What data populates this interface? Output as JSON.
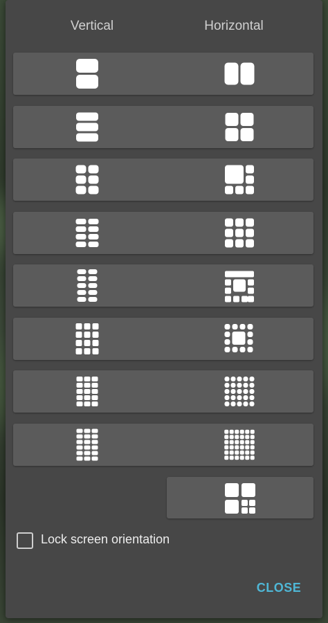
{
  "header": {
    "vertical_label": "Vertical",
    "horizontal_label": "Horizontal"
  },
  "layout_rows": [
    {
      "vertical_icon": "vertical-2-stack-icon",
      "horizontal_icon": "horizontal-2-side-icon"
    },
    {
      "vertical_icon": "vertical-3-stack-icon",
      "horizontal_icon": "grid-2x2-icon"
    },
    {
      "vertical_icon": "grid-2x3-icon",
      "horizontal_icon": "big-plus-5-small-icon"
    },
    {
      "vertical_icon": "grid-2x4-icon",
      "horizontal_icon": "grid-3x3-icon"
    },
    {
      "vertical_icon": "grid-2x5-icon",
      "horizontal_icon": "grid-4x4-two-big-icon"
    },
    {
      "vertical_icon": "grid-3x4-icon",
      "horizontal_icon": "grid-4x4-center-big-icon"
    },
    {
      "vertical_icon": "grid-3x5-icon",
      "horizontal_icon": "grid-5x5-icon"
    },
    {
      "vertical_icon": "grid-3x6-icon",
      "horizontal_icon": "grid-6x6-icon"
    }
  ],
  "extra_layout": {
    "icon": "grid-3-big-4-small-icon"
  },
  "lock_orientation": {
    "label": "Lock screen orientation",
    "checked": false
  },
  "actions": {
    "close_label": "CLOSE"
  },
  "colors": {
    "dialog_bg": "#474747",
    "button_bg": "#5b5b5b",
    "icon_fill": "#ffffff",
    "accent": "#4fb7d6",
    "header_text": "#d0d0d0"
  }
}
